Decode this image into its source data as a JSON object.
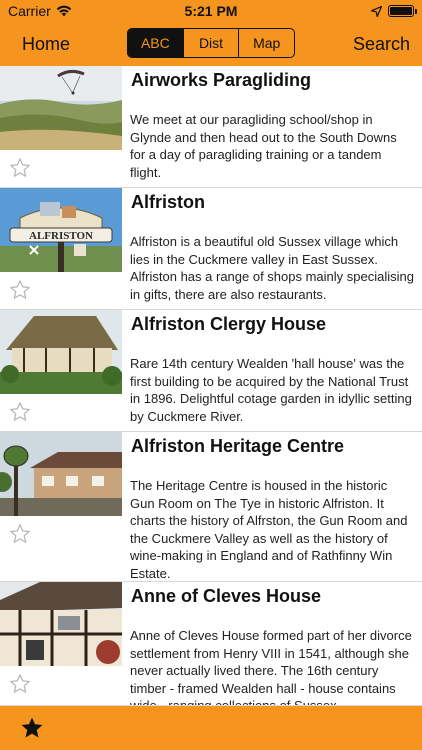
{
  "status": {
    "carrier": "Carrier",
    "time": "5:21 PM"
  },
  "nav": {
    "home_label": "Home",
    "search_label": "Search",
    "segments": [
      "ABC",
      "Dist",
      "Map"
    ],
    "active_segment": "ABC"
  },
  "colors": {
    "accent": "#f5941f",
    "dark": "#111111"
  },
  "items": [
    {
      "title": "Airworks Paragliding",
      "description": "We meet at our paragliding school/shop in Glynde and then head out to the South Downs for a day of paragliding training or a tandem flight.",
      "favorite": false
    },
    {
      "title": "Alfriston",
      "description": "Alfriston is a beautiful old Sussex village which lies in the Cuckmere valley in East Sussex. Alfriston has a range of shops mainly specialising in gifts, there are also restaurants.",
      "favorite": false,
      "sign_text": "ALFRISTON"
    },
    {
      "title": "Alfriston Clergy House",
      "description": "Rare 14th century Wealden 'hall house' was the first building to be acquired by the National Trust in 1896. Delightful cotage garden in idyllic setting by Cuckmere River.",
      "favorite": false
    },
    {
      "title": "Alfriston Heritage Centre",
      "description": "The Heritage Centre is housed in the historic Gun Room on The Tye in historic Alfriston. It charts the history of Alfrston, the Gun Room and the Cuckmere Valley as well as the history of wine-making in England and of Rathfinny Win Estate.",
      "favorite": false
    },
    {
      "title": "Anne of Cleves House",
      "description": "Anne of Cleves House formed part of her divorce settlement from Henry VIII in 1541, although she never actually lived there. The 16th century timber - framed Wealden   hall - house contains wide - ranging collections of Sussex",
      "favorite": false
    }
  ],
  "tabbar": {
    "icon": "star-filled-icon"
  }
}
